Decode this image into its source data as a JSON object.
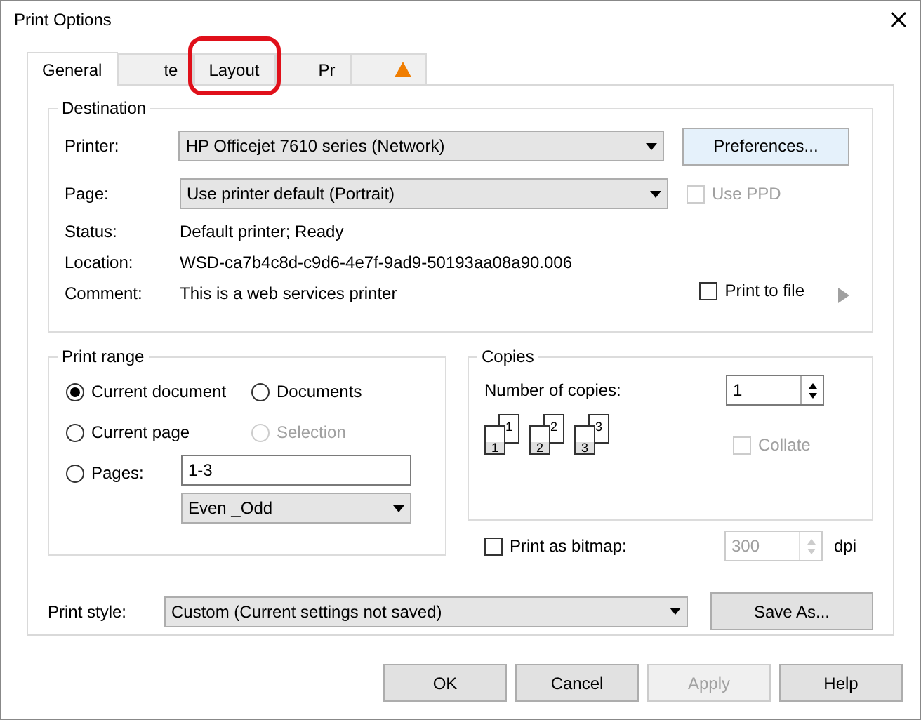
{
  "window": {
    "title": "Print Options"
  },
  "tabs": [
    {
      "label": "General",
      "selected": true,
      "highlighted": false
    },
    {
      "label": "te",
      "selected": false,
      "highlighted": false
    },
    {
      "label": "Layout",
      "selected": false,
      "highlighted": true
    },
    {
      "label": "Pr",
      "selected": false,
      "highlighted": false
    },
    {
      "kind": "warning",
      "selected": false,
      "highlighted": false
    }
  ],
  "destination": {
    "title": "Destination",
    "printer_label": "Printer:",
    "printer": "HP Officejet 7610 series (Network)",
    "preferences": "Preferences...",
    "page_label": "Page:",
    "page": "Use printer default (Portrait)",
    "use_ppd": {
      "label": "Use PPD",
      "checked": false,
      "disabled": true
    },
    "info": [
      {
        "label": "Status:",
        "value": "Default printer; Ready"
      },
      {
        "label": "Location:",
        "value": "WSD-ca7b4c8d-c9d6-4e7f-9ad9-50193aa08a90.006"
      },
      {
        "label": "Comment:",
        "value": "This is a web services printer"
      }
    ],
    "print_to_file": {
      "label": "Print to file",
      "checked": false
    }
  },
  "print_range": {
    "title": "Print range",
    "options": [
      {
        "label": "Current document",
        "selected": true,
        "disabled": false
      },
      {
        "label": "Documents",
        "selected": false,
        "disabled": false
      },
      {
        "label": "Current page",
        "selected": false,
        "disabled": false
      },
      {
        "label": "Selection",
        "selected": false,
        "disabled": true
      },
      {
        "label": "Pages:",
        "selected": false,
        "disabled": false
      }
    ],
    "pages_value": "1-3",
    "subset": "Even _Odd"
  },
  "copies": {
    "title": "Copies",
    "label": "Number of copies:",
    "value": "1",
    "page_sets": [
      {
        "front": "1",
        "back": "1"
      },
      {
        "front": "2",
        "back": "2"
      },
      {
        "front": "3",
        "back": "3"
      }
    ],
    "collate": {
      "label": "Collate",
      "checked": false,
      "disabled": true
    }
  },
  "bitmap": {
    "label": "Print as bitmap:",
    "checked": false,
    "dpi_value": "300",
    "unit": "dpi"
  },
  "print_style": {
    "label": "Print style:",
    "value": "Custom (Current settings not saved)",
    "save_as": "Save As..."
  },
  "buttons": [
    {
      "label": "OK",
      "disabled": false
    },
    {
      "label": "Cancel",
      "disabled": false
    },
    {
      "label": "Apply",
      "disabled": true
    },
    {
      "label": "Help",
      "disabled": false
    }
  ]
}
